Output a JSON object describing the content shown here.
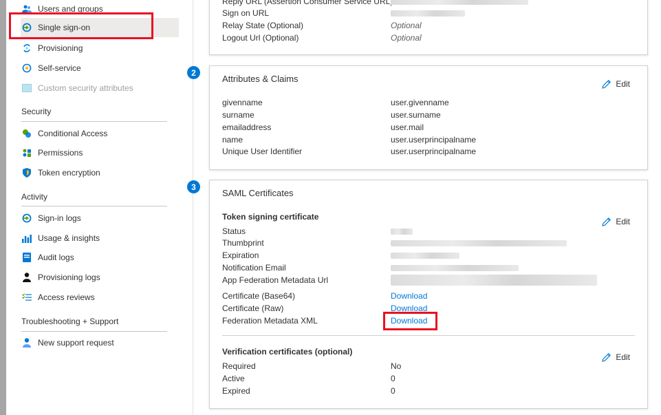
{
  "sidebar": {
    "items_top": [
      {
        "label": "Users and groups",
        "icon": "users-icon"
      },
      {
        "label": "Single sign-on",
        "icon": "sso-icon"
      },
      {
        "label": "Provisioning",
        "icon": "provisioning-icon"
      },
      {
        "label": "Self-service",
        "icon": "self-service-icon"
      },
      {
        "label": "Custom security attributes",
        "icon": "custom-attributes-icon"
      }
    ],
    "security": {
      "heading": "Security",
      "items": [
        {
          "label": "Conditional Access",
          "icon": "conditional-access-icon"
        },
        {
          "label": "Permissions",
          "icon": "permissions-icon"
        },
        {
          "label": "Token encryption",
          "icon": "shield-icon"
        }
      ]
    },
    "activity": {
      "heading": "Activity",
      "items": [
        {
          "label": "Sign-in logs",
          "icon": "sign-in-icon"
        },
        {
          "label": "Usage & insights",
          "icon": "chart-icon"
        },
        {
          "label": "Audit logs",
          "icon": "audit-log-icon"
        },
        {
          "label": "Provisioning logs",
          "icon": "person-icon"
        },
        {
          "label": "Access reviews",
          "icon": "checklist-icon"
        }
      ]
    },
    "support": {
      "heading": "Troubleshooting + Support",
      "items": [
        {
          "label": "New support request",
          "icon": "support-person-icon"
        }
      ]
    }
  },
  "basic_saml": {
    "rows": [
      {
        "label": "Reply URL (Assertion Consumer Service URL)"
      },
      {
        "label": "Sign on URL"
      },
      {
        "label": "Relay State (Optional)",
        "value": "Optional"
      },
      {
        "label": "Logout Url (Optional)",
        "value": "Optional"
      }
    ]
  },
  "attributes": {
    "step": "2",
    "title": "Attributes & Claims",
    "edit_label": "Edit",
    "rows": [
      {
        "label": "givenname",
        "value": "user.givenname"
      },
      {
        "label": "surname",
        "value": "user.surname"
      },
      {
        "label": "emailaddress",
        "value": "user.mail"
      },
      {
        "label": "name",
        "value": "user.userprincipalname"
      },
      {
        "label": "Unique User Identifier",
        "value": "user.userprincipalname"
      }
    ]
  },
  "saml_certs": {
    "step": "3",
    "title": "SAML Certificates",
    "token_signing": {
      "heading": "Token signing certificate",
      "edit_label": "Edit",
      "rows": [
        {
          "label": "Status"
        },
        {
          "label": "Thumbprint"
        },
        {
          "label": "Expiration"
        },
        {
          "label": "Notification Email"
        },
        {
          "label": "App Federation Metadata Url"
        }
      ],
      "downloads": [
        {
          "label": "Certificate (Base64)",
          "link": "Download"
        },
        {
          "label": "Certificate (Raw)",
          "link": "Download"
        },
        {
          "label": "Federation Metadata XML",
          "link": "Download"
        }
      ]
    },
    "verification": {
      "heading": "Verification certificates (optional)",
      "edit_label": "Edit",
      "rows": [
        {
          "label": "Required",
          "value": "No"
        },
        {
          "label": "Active",
          "value": "0"
        },
        {
          "label": "Expired",
          "value": "0"
        }
      ]
    }
  },
  "colors": {
    "accent": "#0078d4",
    "highlight": "#e81123",
    "active_bg": "#edebe9"
  }
}
